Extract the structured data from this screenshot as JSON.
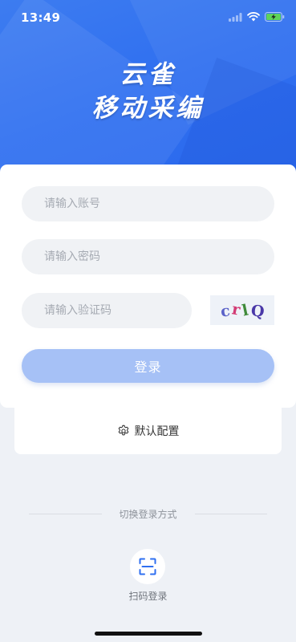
{
  "status_bar": {
    "time": "13:49"
  },
  "app": {
    "title_line1": "云雀",
    "title_line2": "移动采编",
    "brand_color": "#2f6ff0"
  },
  "login_form": {
    "account_placeholder": "请输入账号",
    "password_placeholder": "请输入密码",
    "captcha_placeholder": "请输入验证码",
    "captcha_chars": [
      "c",
      "r",
      "l",
      "Q"
    ],
    "captcha_colors": [
      "#5a62c8",
      "#d23b74",
      "#3f8a3a",
      "#4a38a8"
    ],
    "login_label": "登录",
    "login_button_color": "#a6c1f6"
  },
  "config": {
    "label": "默认配置",
    "icon": "gear-icon"
  },
  "alt_login": {
    "divider_text": "切换登录方式",
    "scan_label": "扫码登录",
    "scan_icon": "scan-icon"
  }
}
